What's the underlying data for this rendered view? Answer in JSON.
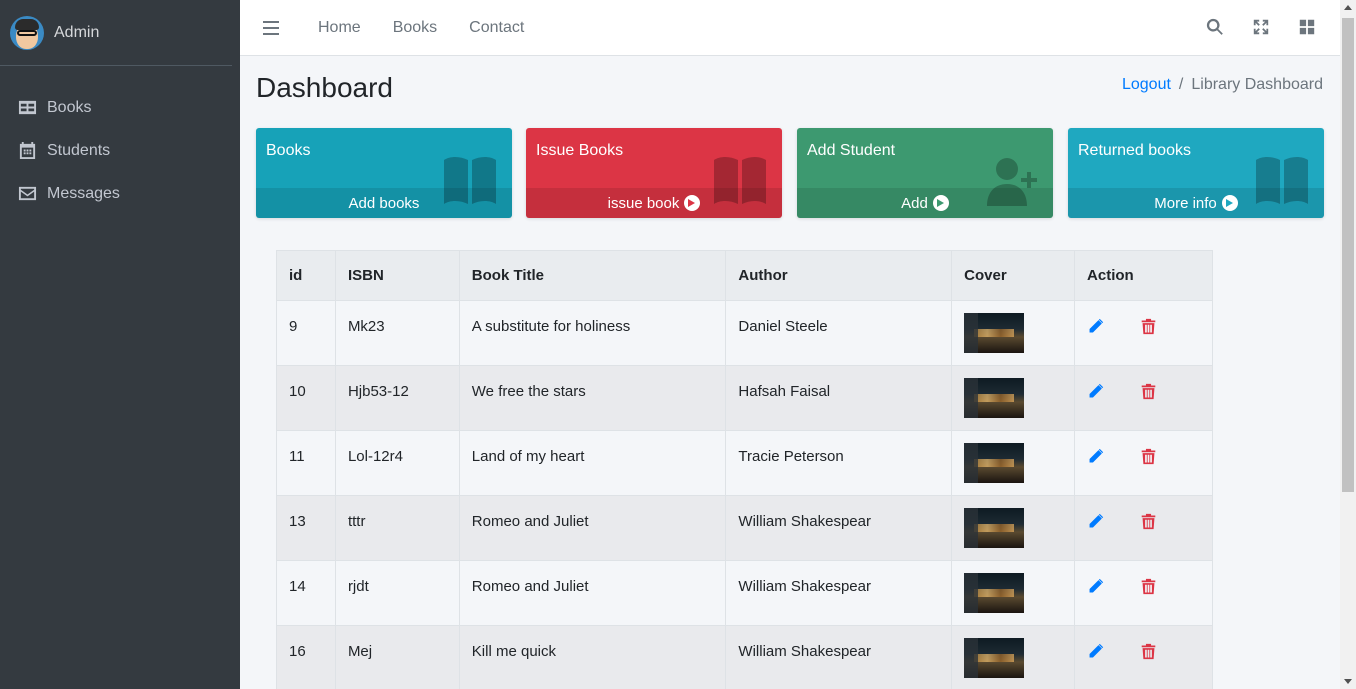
{
  "sidebar": {
    "user": "Admin",
    "items": [
      {
        "label": "Books",
        "icon": "table-icon"
      },
      {
        "label": "Students",
        "icon": "calendar-icon"
      },
      {
        "label": "Messages",
        "icon": "envelope-icon"
      }
    ]
  },
  "topbar": {
    "links": [
      "Home",
      "Books",
      "Contact"
    ]
  },
  "header": {
    "title": "Dashboard",
    "breadcrumb_link": "Logout",
    "breadcrumb_sep": "/",
    "breadcrumb_current": "Library Dashboard"
  },
  "boxes": [
    {
      "title": "Books",
      "footer": "Add books",
      "color": "#17a2b8",
      "icon": "book-icon",
      "arrow": false
    },
    {
      "title": "Issue Books",
      "footer": "issue book",
      "color": "#dc3545",
      "icon": "book-icon",
      "arrow": true
    },
    {
      "title": "Add Student",
      "footer": "Add",
      "color": "#3d9970",
      "icon": "user-plus-icon",
      "arrow": true
    },
    {
      "title": "Returned books",
      "footer": "More info",
      "color": "#1fa8c0",
      "icon": "book-icon",
      "arrow": true
    }
  ],
  "table": {
    "headers": [
      "id",
      "ISBN",
      "Book Title",
      "Author",
      "Cover",
      "Action"
    ],
    "rows": [
      {
        "id": "9",
        "isbn": "Mk23",
        "title": "A substitute for holiness",
        "author": "Daniel Steele"
      },
      {
        "id": "10",
        "isbn": "Hjb53-12",
        "title": "We free the stars",
        "author": "Hafsah Faisal"
      },
      {
        "id": "11",
        "isbn": "Lol-12r4",
        "title": "Land of my heart",
        "author": "Tracie Peterson"
      },
      {
        "id": "13",
        "isbn": "tttr",
        "title": "Romeo and Juliet",
        "author": "William Shakespear"
      },
      {
        "id": "14",
        "isbn": "rjdt",
        "title": "Romeo and Juliet",
        "author": "William Shakespear"
      },
      {
        "id": "16",
        "isbn": "Mej",
        "title": "Kill me quick",
        "author": "William Shakespear"
      }
    ]
  },
  "colors": {
    "edit": "#007bff",
    "delete": "#dc3545",
    "sidebar": "#343a40"
  }
}
